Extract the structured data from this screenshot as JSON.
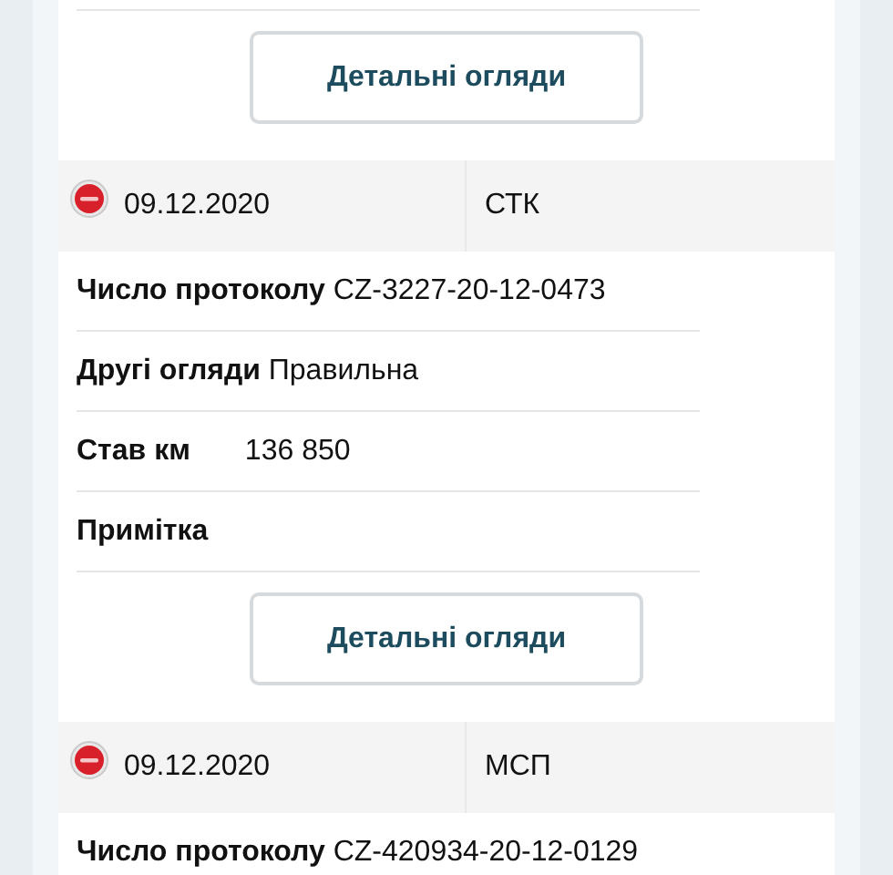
{
  "top_button": "Детальні огляди",
  "inspections": [
    {
      "date": "09.12.2020",
      "type": "СТК",
      "fields": [
        {
          "kind": "inline",
          "label": "Число протоколу",
          "value": "CZ-3227-20-12-0473"
        },
        {
          "kind": "inline",
          "label": "Другі огляди",
          "value": "Правильна"
        },
        {
          "kind": "column",
          "label": "Став км",
          "value": "136 850"
        },
        {
          "kind": "inline",
          "label": "Примітка"
        }
      ],
      "button": "Детальні огляди"
    },
    {
      "date": "09.12.2020",
      "type": "МСП",
      "fields": [
        {
          "kind": "inline",
          "label": "Число протоколу",
          "value": "CZ-420934-20-12-0129"
        }
      ]
    }
  ]
}
